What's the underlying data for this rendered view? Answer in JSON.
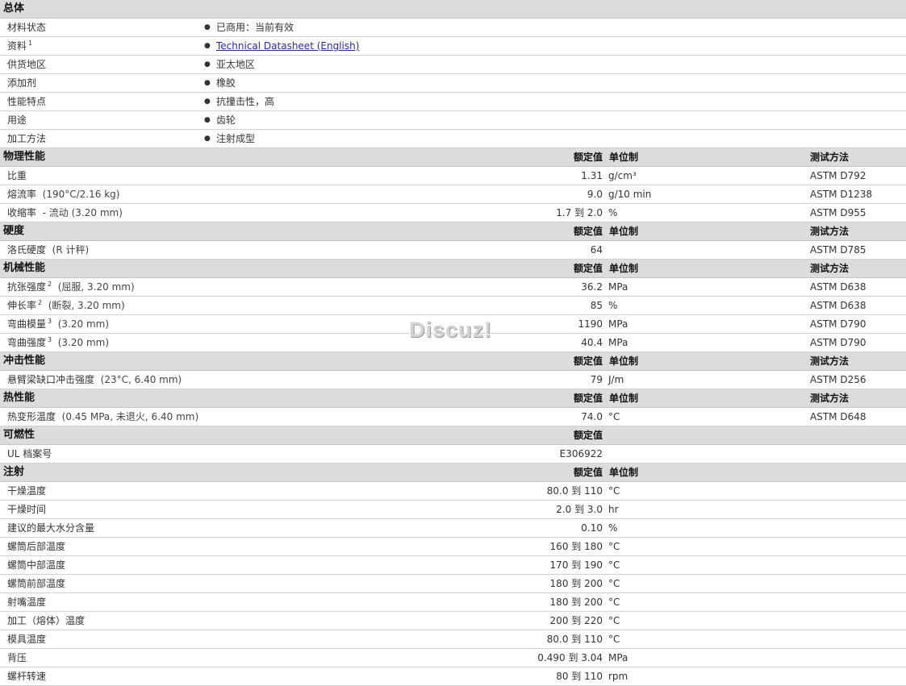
{
  "sections": [
    {
      "name": "总体",
      "headers": null,
      "rows": [
        {
          "kind": "info",
          "name": "材料状态",
          "sup": "",
          "value": "已商用：当前有效"
        },
        {
          "kind": "info",
          "name": "资料",
          "sup": "1",
          "value": "Technical Datasheet (English)",
          "link": true
        },
        {
          "kind": "info",
          "name": "供货地区",
          "sup": "",
          "value": "亚太地区"
        },
        {
          "kind": "info",
          "name": "添加剂",
          "sup": "",
          "value": "橡胶"
        },
        {
          "kind": "info",
          "name": "性能特点",
          "sup": "",
          "value": "抗撞击性，高"
        },
        {
          "kind": "info",
          "name": "用途",
          "sup": "",
          "value": "齿轮"
        },
        {
          "kind": "info",
          "name": "加工方法",
          "sup": "",
          "value": "注射成型"
        }
      ]
    },
    {
      "name": "物理性能",
      "headers": {
        "value": "额定值",
        "unit": "单位制",
        "test": "测试方法"
      },
      "rows": [
        {
          "name": "比重",
          "sup": "",
          "cond": "",
          "value": "1.31",
          "unit": "g/cm³",
          "test": "ASTM D792"
        },
        {
          "name": "熔流率",
          "sup": "",
          "cond": "(190°C/2.16 kg)",
          "value": "9.0",
          "unit": "g/10 min",
          "test": "ASTM D1238"
        },
        {
          "name": "收缩率",
          "sup": "",
          "cond": "- 流动 (3.20 mm)",
          "value": "1.7 到  2.0",
          "unit": "%",
          "test": "ASTM D955"
        }
      ]
    },
    {
      "name": "硬度",
      "headers": {
        "value": "额定值",
        "unit": "单位制",
        "test": "测试方法"
      },
      "rows": [
        {
          "name": "洛氏硬度",
          "sup": "",
          "cond": "(R 计秤)",
          "value": "64",
          "unit": "",
          "test": "ASTM D785"
        }
      ]
    },
    {
      "name": "机械性能",
      "headers": {
        "value": "额定值",
        "unit": "单位制",
        "test": "测试方法"
      },
      "rows": [
        {
          "name": "抗张强度",
          "sup": "2",
          "cond": "(屈服, 3.20 mm)",
          "value": "36.2",
          "unit": "MPa",
          "test": "ASTM D638"
        },
        {
          "name": "伸长率",
          "sup": "2",
          "cond": "(断裂, 3.20 mm)",
          "value": "85",
          "unit": "%",
          "test": "ASTM D638"
        },
        {
          "name": "弯曲模量",
          "sup": "3",
          "cond": "(3.20 mm)",
          "value": "1190",
          "unit": "MPa",
          "test": "ASTM D790"
        },
        {
          "name": "弯曲强度",
          "sup": "3",
          "cond": "(3.20 mm)",
          "value": "40.4",
          "unit": "MPa",
          "test": "ASTM D790"
        }
      ]
    },
    {
      "name": "冲击性能",
      "headers": {
        "value": "额定值",
        "unit": "单位制",
        "test": "测试方法"
      },
      "rows": [
        {
          "name": "悬臂梁缺口冲击强度",
          "sup": "",
          "cond": "(23°C, 6.40 mm)",
          "value": "79",
          "unit": "J/m",
          "test": "ASTM D256"
        }
      ]
    },
    {
      "name": "热性能",
      "headers": {
        "value": "额定值",
        "unit": "单位制",
        "test": "测试方法"
      },
      "rows": [
        {
          "name": "热变形温度",
          "sup": "",
          "cond": "(0.45 MPa, 未退火, 6.40 mm)",
          "value": "74.0",
          "unit": "°C",
          "test": "ASTM D648"
        }
      ]
    },
    {
      "name": "可燃性",
      "headers": {
        "value": "额定值",
        "unit": "",
        "test": ""
      },
      "rows": [
        {
          "name": "UL 档案号",
          "sup": "",
          "cond": "",
          "value": "E306922",
          "unit": "",
          "test": ""
        }
      ]
    },
    {
      "name": "注射",
      "headers": {
        "value": "额定值",
        "unit": "单位制",
        "test": ""
      },
      "rows": [
        {
          "name": "干燥温度",
          "sup": "",
          "cond": "",
          "value": "80.0 到  110",
          "unit": "°C",
          "test": ""
        },
        {
          "name": "干燥时间",
          "sup": "",
          "cond": "",
          "value": "2.0 到  3.0",
          "unit": "hr",
          "test": ""
        },
        {
          "name": "建议的最大水分含量",
          "sup": "",
          "cond": "",
          "value": "0.10",
          "unit": "%",
          "test": ""
        },
        {
          "name": "螺筒后部温度",
          "sup": "",
          "cond": "",
          "value": "160 到  180",
          "unit": "°C",
          "test": ""
        },
        {
          "name": "螺筒中部温度",
          "sup": "",
          "cond": "",
          "value": "170 到  190",
          "unit": "°C",
          "test": ""
        },
        {
          "name": "螺筒前部温度",
          "sup": "",
          "cond": "",
          "value": "180 到  200",
          "unit": "°C",
          "test": ""
        },
        {
          "name": "射嘴温度",
          "sup": "",
          "cond": "",
          "value": "180 到  200",
          "unit": "°C",
          "test": ""
        },
        {
          "name": "加工（熔体）温度",
          "sup": "",
          "cond": "",
          "value": "200 到  220",
          "unit": "°C",
          "test": ""
        },
        {
          "name": "模具温度",
          "sup": "",
          "cond": "",
          "value": "80.0 到  110",
          "unit": "°C",
          "test": ""
        },
        {
          "name": "背压",
          "sup": "",
          "cond": "",
          "value": "0.490 到  3.04",
          "unit": "MPa",
          "test": ""
        },
        {
          "name": "螺杆转速",
          "sup": "",
          "cond": "",
          "value": "80 到  110",
          "unit": "rpm",
          "test": ""
        }
      ]
    }
  ],
  "watermark": "Discuz!"
}
